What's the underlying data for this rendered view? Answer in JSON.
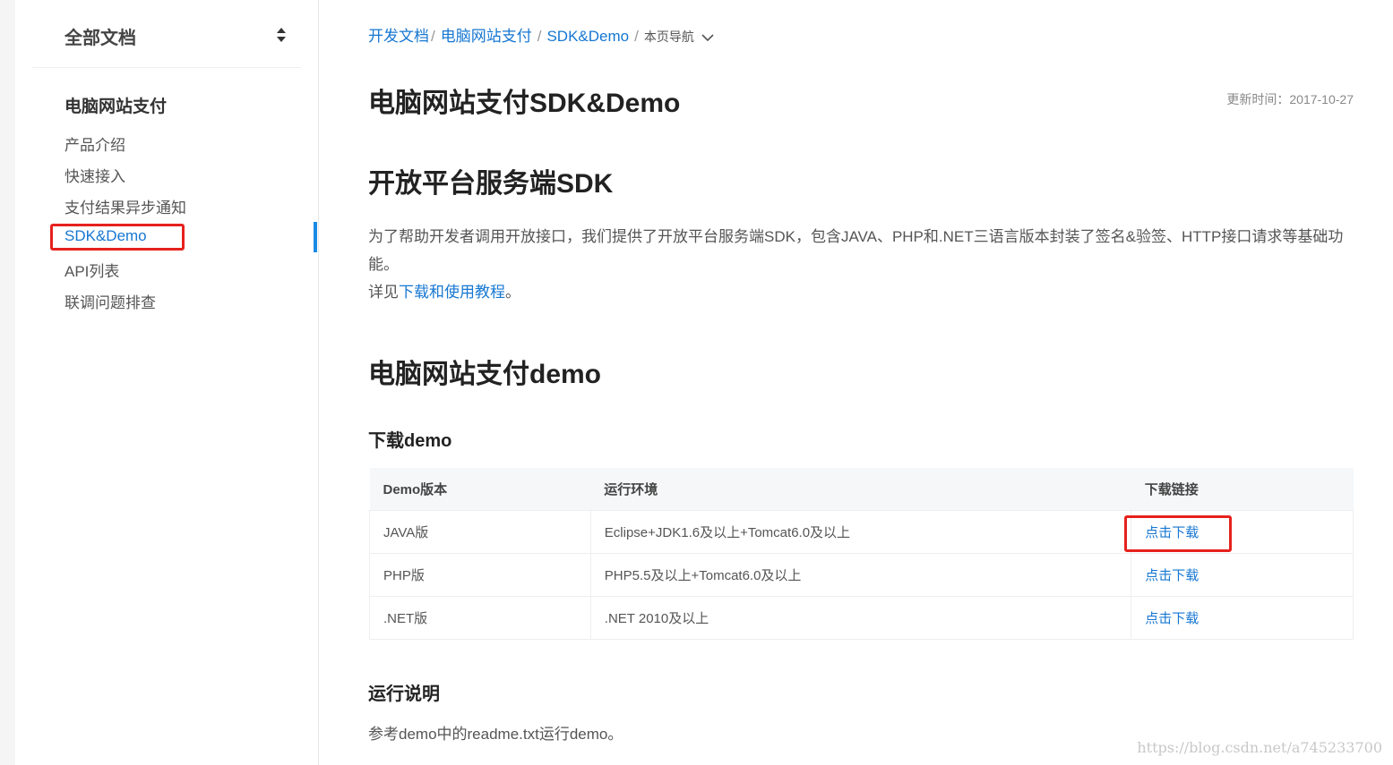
{
  "sidebar": {
    "doc_selector_label": "全部文档",
    "section_title": "电脑网站支付",
    "items": [
      {
        "label": "产品介绍"
      },
      {
        "label": "快速接入"
      },
      {
        "label": "支付结果异步通知"
      },
      {
        "label": "SDK&Demo"
      },
      {
        "label": "API列表"
      },
      {
        "label": "联调问题排查"
      }
    ]
  },
  "breadcrumb": {
    "items": [
      "开发文档",
      "电脑网站支付",
      "SDK&Demo"
    ],
    "current": "本页导航"
  },
  "page": {
    "title": "电脑网站支付SDK&Demo",
    "update_time": "更新时间：2017-10-27",
    "sdk_heading": "开放平台服务端SDK",
    "sdk_desc": "为了帮助开发者调用开放接口，我们提供了开放平台服务端SDK，包含JAVA、PHP和.NET三语言版本封装了签名&验签、HTTP接口请求等基础功能。",
    "detail_prefix": "详见",
    "detail_link": "下载和使用教程",
    "detail_suffix": "。",
    "demo_heading": "电脑网站支付demo",
    "download_heading": "下载demo",
    "run_heading": "运行说明",
    "run_desc": "参考demo中的readme.txt运行demo。"
  },
  "table": {
    "headers": [
      "Demo版本",
      "运行环境",
      "下载链接"
    ],
    "rows": [
      {
        "version": "JAVA版",
        "env": "Eclipse+JDK1.6及以上+Tomcat6.0及以上",
        "link": "点击下载"
      },
      {
        "version": "PHP版",
        "env": "PHP5.5及以上+Tomcat6.0及以上",
        "link": "点击下载"
      },
      {
        "version": ".NET版",
        "env": ".NET 2010及以上",
        "link": "点击下载"
      }
    ]
  },
  "watermark": "https://blog.csdn.net/a745233700",
  "colors": {
    "accent": "#1677d2",
    "highlight": "#e6211d"
  }
}
